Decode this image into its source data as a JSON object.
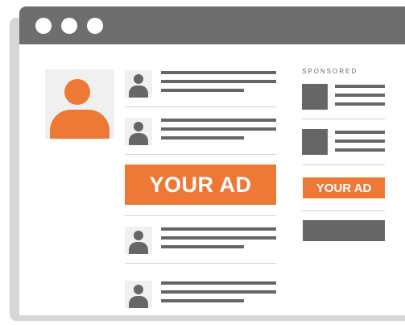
{
  "colors": {
    "accent": "#ee7936",
    "dark_gray": "#666666",
    "titlebar": "#6e6e6e",
    "light_gray": "#f0f0f0",
    "shadow": "#d6d6d6"
  },
  "window": {
    "controls": [
      "circle-icon",
      "circle-icon",
      "circle-icon"
    ]
  },
  "profile": {
    "icon": "user-avatar-icon"
  },
  "feed": {
    "ad_label": "YOUR AD"
  },
  "sidebar": {
    "heading": "SPONSORED",
    "ad_label": "YOUR AD"
  }
}
